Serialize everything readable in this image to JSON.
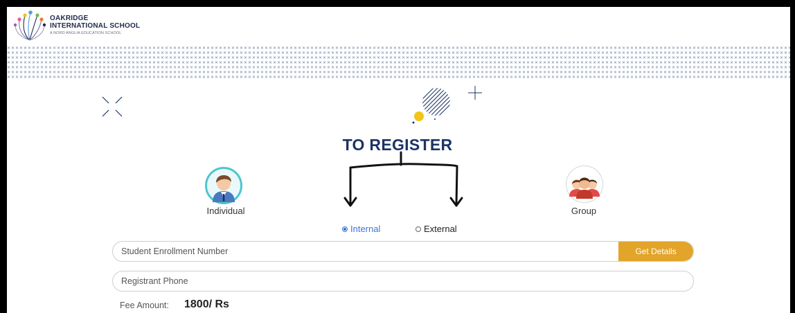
{
  "header": {
    "brand_line1": "OAKRIDGE",
    "brand_line2": "INTERNATIONAL SCHOOL",
    "brand_line3": "A NORD ANGLIA EDUCATION SCHOOL"
  },
  "page": {
    "title": "TO REGISTER"
  },
  "registration_types": [
    {
      "label": "Individual",
      "icon": "individual-avatar-icon"
    },
    {
      "label": "Group",
      "icon": "group-avatar-icon"
    }
  ],
  "student_type": {
    "options": [
      {
        "label": "Internal",
        "selected": true
      },
      {
        "label": "External",
        "selected": false
      }
    ]
  },
  "form": {
    "enrollment_placeholder": "Student Enrollment Number",
    "enrollment_value": "",
    "get_details_label": "Get Details",
    "phone_placeholder": "Registrant Phone",
    "phone_value": "",
    "fee_label": "Fee Amount:",
    "fee_value": "1800/ Rs"
  },
  "colors": {
    "title": "#1b3366",
    "accent_button": "#e2a52a",
    "radio_selected": "#3d73d4",
    "avatar_ring": "#4fc5cf",
    "deco_yellow": "#f2c417"
  }
}
